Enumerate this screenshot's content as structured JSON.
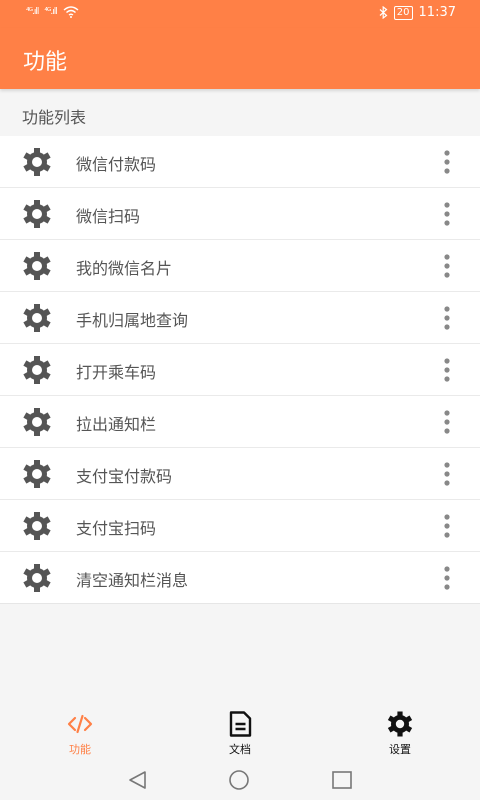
{
  "status_bar": {
    "signal1": "⁴ᴳ.ıll",
    "signal2": "⁴ᴳ.ıll",
    "battery": "20",
    "time": "11:37"
  },
  "app_bar": {
    "title": "功能"
  },
  "section": {
    "label": "功能列表"
  },
  "list": {
    "items": [
      {
        "label": "微信付款码"
      },
      {
        "label": "微信扫码"
      },
      {
        "label": "我的微信名片"
      },
      {
        "label": "手机归属地查询"
      },
      {
        "label": "打开乘车码"
      },
      {
        "label": "拉出通知栏"
      },
      {
        "label": "支付宝付款码"
      },
      {
        "label": "支付宝扫码"
      },
      {
        "label": "清空通知栏消息"
      }
    ]
  },
  "bottom_nav": {
    "tabs": [
      {
        "label": "功能",
        "icon": "code-icon",
        "active": true
      },
      {
        "label": "文档",
        "icon": "document-icon",
        "active": false
      },
      {
        "label": "设置",
        "icon": "gear-icon",
        "active": false
      }
    ]
  },
  "colors": {
    "accent": "#ff8046",
    "text": "#555555",
    "icon": "#555555"
  }
}
